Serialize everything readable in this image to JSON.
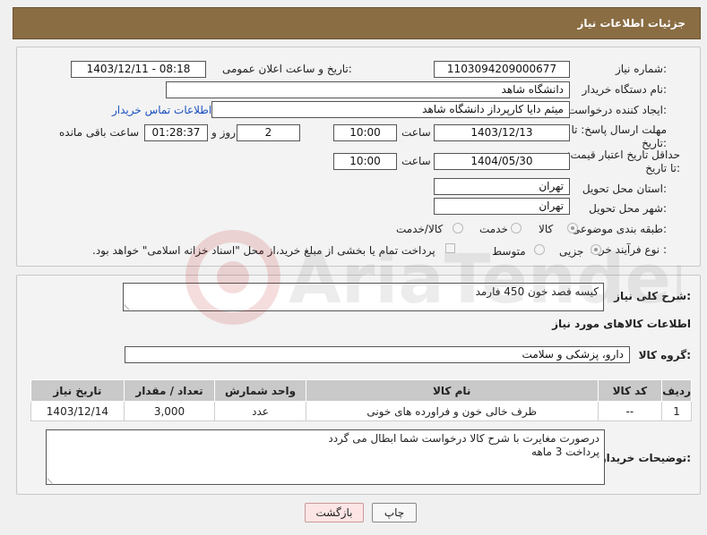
{
  "header": {
    "title": "جزئیات اطلاعات نیاز"
  },
  "fields": {
    "need_number_label": "شماره نیاز:",
    "need_number": "1103094209000677",
    "announce_label": "تاریخ و ساعت اعلان عمومی:",
    "announce_value": "1403/12/11 - 08:18",
    "buyer_org_label": "نام دستگاه خریدار:",
    "buyer_org": "دانشگاه شاهد",
    "creator_label": "ایجاد کننده درخواست:",
    "creator": "میثم دایا کارپرداز دانشگاه شاهد",
    "contact_link": "اطلاعات تماس خریدار",
    "reply_deadline_label": "مهلت ارسال پاسخ: تا تاریخ:",
    "reply_date": "1403/12/13",
    "time_label": "ساعت",
    "reply_time": "10:00",
    "days": "2",
    "days_label": "روز و",
    "remaining": "01:28:37",
    "remaining_label": "ساعت باقی مانده",
    "price_deadline_label": "حداقل تاریخ اعتبار قیمت: تا تاریخ:",
    "price_date": "1404/05/30",
    "price_time": "10:00",
    "province_label": "استان محل تحویل:",
    "province": "تهران",
    "city_label": "شهر محل تحویل:",
    "city": "تهران",
    "category_label": "طبقه بندی موضوعی:",
    "category_options": [
      "کالا",
      "خدمت",
      "کالا/خدمت"
    ],
    "process_label": "نوع فرآیند خرید :",
    "process_options": [
      "جزیی",
      "متوسط"
    ],
    "payment_note": "پرداخت تمام یا بخشی از مبلغ خرید،از محل \"اسناد خزانه اسلامی\" خواهد بود."
  },
  "description": {
    "label": "شرح کلی نیاز:",
    "value": "کیسه فصد خون 450 فارمد"
  },
  "goods": {
    "section_title": "اطلاعات کالاهای مورد نیاز",
    "group_label": "گروه کالا:",
    "group_value": "دارو، پزشکی و سلامت",
    "columns": [
      "ردیف",
      "کد کالا",
      "نام کالا",
      "واحد شمارش",
      "تعداد / مقدار",
      "تاریخ نیاز"
    ],
    "rows": [
      [
        "1",
        "--",
        "ظرف خالی خون و فراورده های خونی",
        "عدد",
        "3,000",
        "1403/12/14"
      ]
    ]
  },
  "buyer_notes": {
    "label": "توضیحات خریدار:",
    "line1": "درصورت مغایرت با شرح کالا درخواست شما ابطال می گردد",
    "line2": "پرداخت 3 ماهه"
  },
  "buttons": {
    "print": "چاپ",
    "back": "بازگشت"
  },
  "watermark": "AriaTender.neT"
}
